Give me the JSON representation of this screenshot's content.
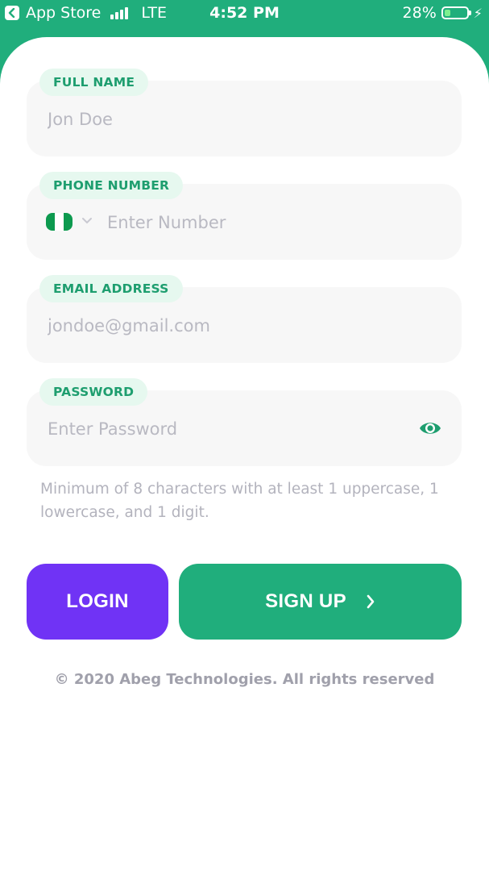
{
  "status_bar": {
    "back_app": "App Store",
    "network": "LTE",
    "time": "4:52 PM",
    "battery": "28%",
    "battery_level": 0.28
  },
  "form": {
    "full_name": {
      "label": "FULL NAME",
      "placeholder": "Jon Doe"
    },
    "phone": {
      "label": "PHONE NUMBER",
      "placeholder": "Enter Number",
      "country_flag": "nigeria-flag",
      "flag_colors": [
        "#0d9a4f",
        "#ffffff",
        "#0d9a4f"
      ]
    },
    "email": {
      "label": "EMAIL ADDRESS",
      "placeholder": "jondoe@gmail.com"
    },
    "password": {
      "label": "PASSWORD",
      "placeholder": "Enter Password",
      "toggle_icon": "eye-icon"
    },
    "password_hint": "Minimum of 8 characters with at least 1 uppercase, 1 lowercase, and 1 digit."
  },
  "buttons": {
    "login": "LOGIN",
    "signup": "SIGN UP"
  },
  "footer": "© 2020 Abeg Technologies. All rights reserved",
  "colors": {
    "brand_green": "#20ae7c",
    "accent_purple": "#7033f5",
    "chip_bg": "#e6f8ef",
    "field_bg": "#f7f7f7"
  }
}
